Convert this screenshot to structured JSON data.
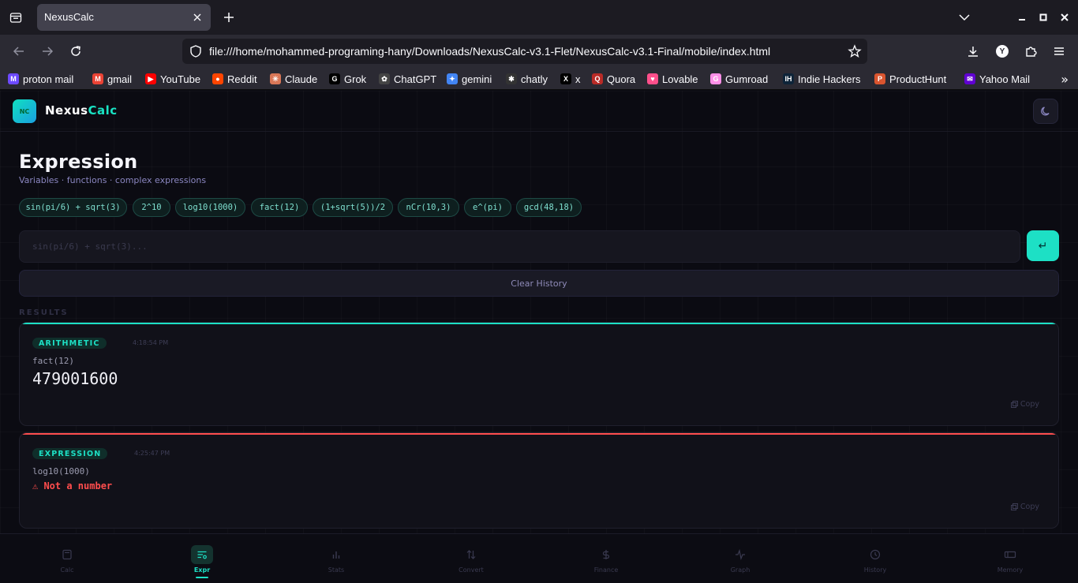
{
  "browser": {
    "tab_title": "NexusCalc",
    "url": "file:///home/mohammed-programing-hany/Downloads/NexusCalc-v3.1-Flet/NexusCalc-v3.1-Final/mobile/index.html",
    "bookmarks": [
      {
        "label": "proton mail",
        "icon": "proton-icon",
        "color": "#6d4aff"
      },
      {
        "label": "gmail",
        "icon": "gmail-icon",
        "color": "#ea4335"
      },
      {
        "label": "YouTube",
        "icon": "youtube-icon",
        "color": "#ff0000"
      },
      {
        "label": "Reddit",
        "icon": "reddit-icon",
        "color": "#ff4500"
      },
      {
        "label": "Claude",
        "icon": "claude-icon",
        "color": "#d97757"
      },
      {
        "label": "Grok",
        "icon": "grok-icon",
        "color": "#000000"
      },
      {
        "label": "ChatGPT",
        "icon": "chatgpt-icon",
        "color": "#444444"
      },
      {
        "label": "gemini",
        "icon": "gemini-icon",
        "color": "#4285f4"
      },
      {
        "label": "chatly",
        "icon": "chatly-icon",
        "color": "#333333"
      },
      {
        "label": "x",
        "icon": "x-icon",
        "color": "#000000"
      },
      {
        "label": "Quora",
        "icon": "quora-icon",
        "color": "#b92b27"
      },
      {
        "label": "Lovable",
        "icon": "lovable-icon",
        "color": "#ff4f8b"
      },
      {
        "label": "Gumroad",
        "icon": "gumroad-icon",
        "color": "#ff90e8"
      },
      {
        "label": "Indie Hackers",
        "icon": "indiehackers-icon",
        "color": "#0e2439"
      },
      {
        "label": "ProductHunt",
        "icon": "producthunt-icon",
        "color": "#da552f"
      },
      {
        "label": "Yahoo Mail",
        "icon": "yahoo-icon",
        "color": "#6001d2"
      }
    ]
  },
  "app": {
    "logo_badge": "NC",
    "logo_part1": "Nexus",
    "logo_part2": "Calc",
    "accent": "#1de0c5",
    "error_color": "#ff4d4d"
  },
  "page": {
    "title": "Expression",
    "subtitle": "Variables · functions · complex expressions"
  },
  "examples": [
    "sin(pi/6) + sqrt(3)",
    "2^10",
    "log10(1000)",
    "fact(12)",
    "(1+sqrt(5))/2",
    "nCr(10,3)",
    "e^(pi)",
    "gcd(48,18)"
  ],
  "input": {
    "placeholder": "sin(pi/6) + sqrt(3)...",
    "value": "",
    "submit_glyph": "↵"
  },
  "clear_label": "Clear History",
  "results_label": "RESULTS",
  "results": [
    {
      "tag": "ARITHMETIC",
      "time": "4:18:54 PM",
      "expr": "fact(12)",
      "value": "479001600",
      "error": "",
      "copy": "Copy",
      "bar_color": "#1de0c5"
    },
    {
      "tag": "EXPRESSION",
      "time": "4:25:47 PM",
      "expr": "log10(1000)",
      "value": "",
      "error": "⚠ Not a number",
      "copy": "Copy",
      "bar_color": "#ff4d4d"
    }
  ],
  "nav": [
    {
      "label": "Calc",
      "icon": "calculator-icon",
      "active": false
    },
    {
      "label": "Expr",
      "icon": "expression-icon",
      "active": true
    },
    {
      "label": "Stats",
      "icon": "bar-chart-icon",
      "active": false
    },
    {
      "label": "Convert",
      "icon": "swap-icon",
      "active": false
    },
    {
      "label": "Finance",
      "icon": "dollar-icon",
      "active": false
    },
    {
      "label": "Graph",
      "icon": "pulse-icon",
      "active": false
    },
    {
      "label": "History",
      "icon": "clock-icon",
      "active": false
    },
    {
      "label": "Memory",
      "icon": "memory-icon",
      "active": false
    }
  ]
}
